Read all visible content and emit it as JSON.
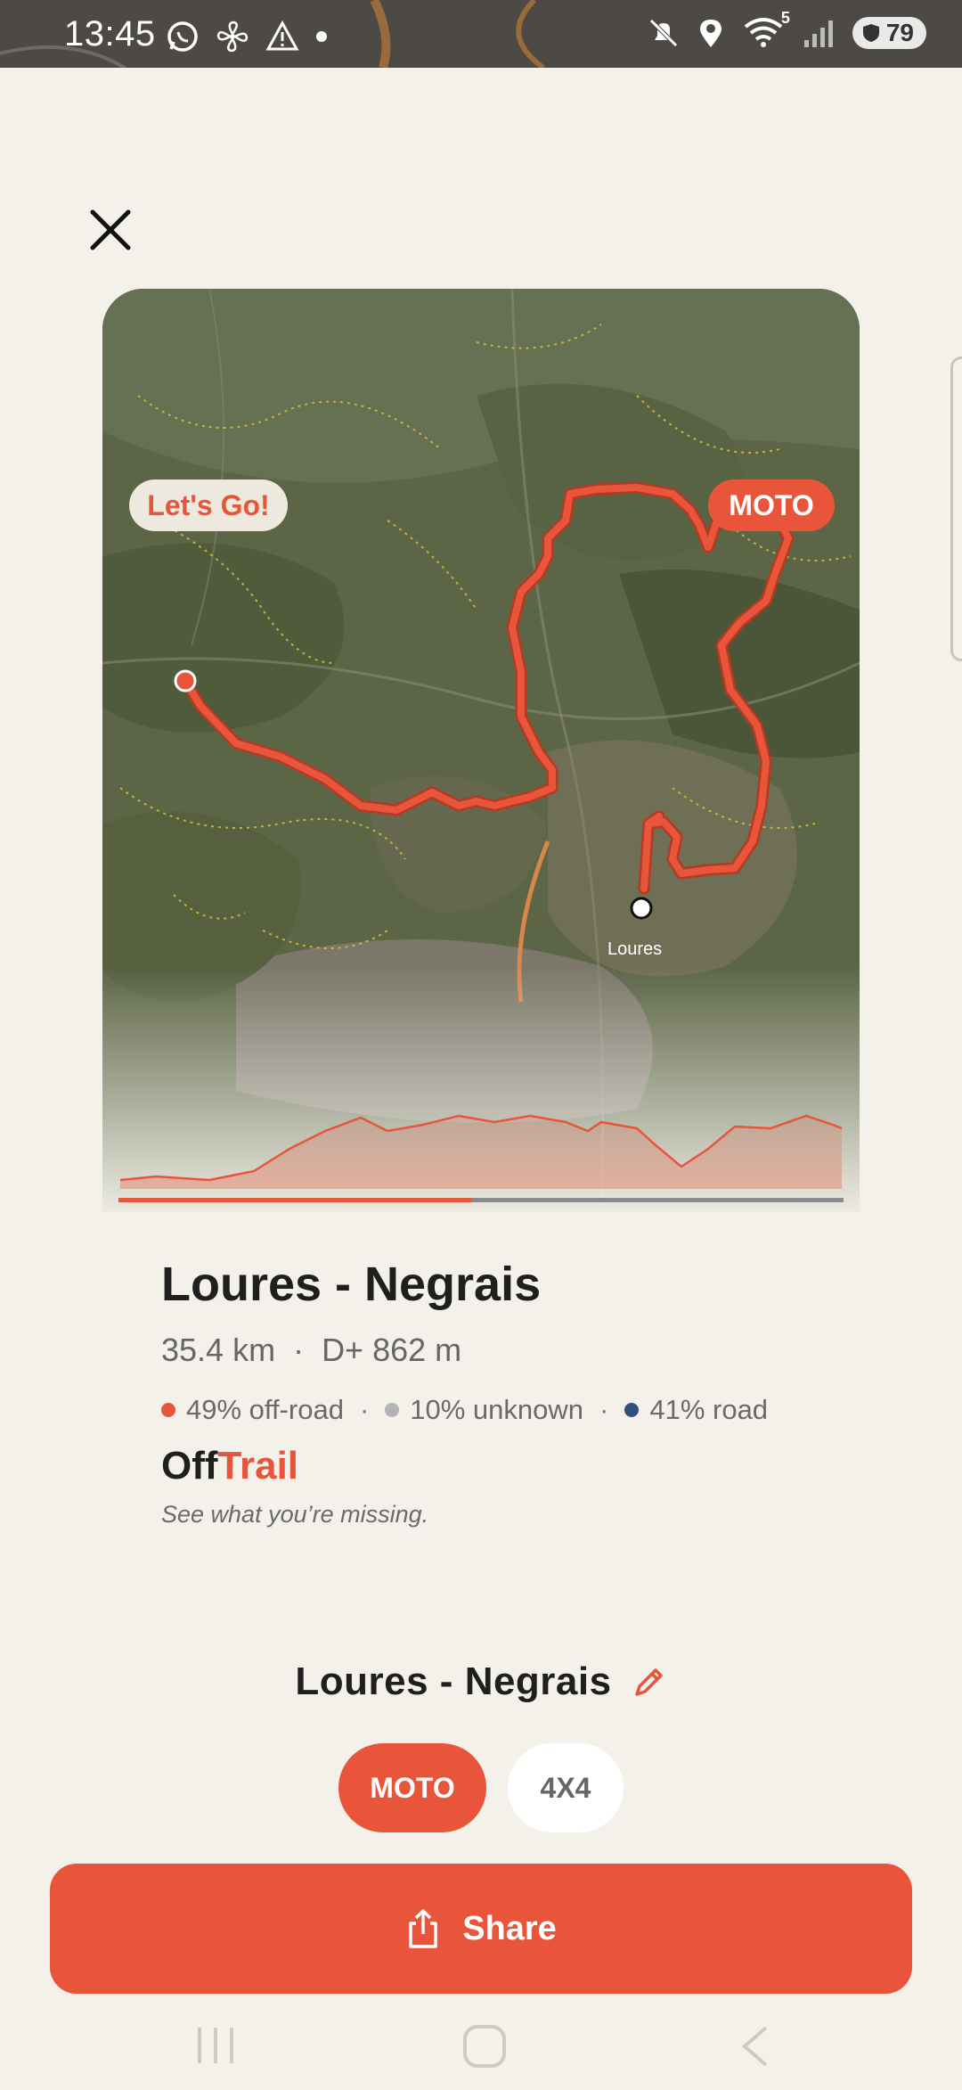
{
  "status_bar": {
    "time": "13:45",
    "wifi_badge": "5",
    "battery": "79"
  },
  "map_card": {
    "left_badge": "Let's Go!",
    "right_badge": "MOTO",
    "place_label": "Loures"
  },
  "route": {
    "title": "Loures - Negrais",
    "distance": "35.4 km",
    "separator": "·",
    "elevation": "D+ 862 m",
    "surface": [
      {
        "label": "49% off-road",
        "color": "#e8553a"
      },
      {
        "label": "10% unknown",
        "color": "#b3b3b3"
      },
      {
        "label": "41% road",
        "color": "#2f4f7f"
      }
    ]
  },
  "brand": {
    "part1": "Off",
    "part2": "Trail",
    "tagline": "See what you’re missing."
  },
  "editor": {
    "route_name": "Loures - Negrais",
    "chips": [
      {
        "label": "MOTO",
        "active": true
      },
      {
        "label": "4X4",
        "active": false
      }
    ]
  },
  "share": {
    "label": "Share"
  },
  "colors": {
    "accent": "#e8553a",
    "background": "#f4f1ea"
  },
  "icons": [
    "close-icon",
    "edit-pencil-icon",
    "share-icon",
    "whatsapp-icon",
    "fan-icon",
    "warning-icon",
    "mute-icon",
    "location-icon",
    "wifi-icon",
    "signal-icon",
    "shield-icon"
  ]
}
